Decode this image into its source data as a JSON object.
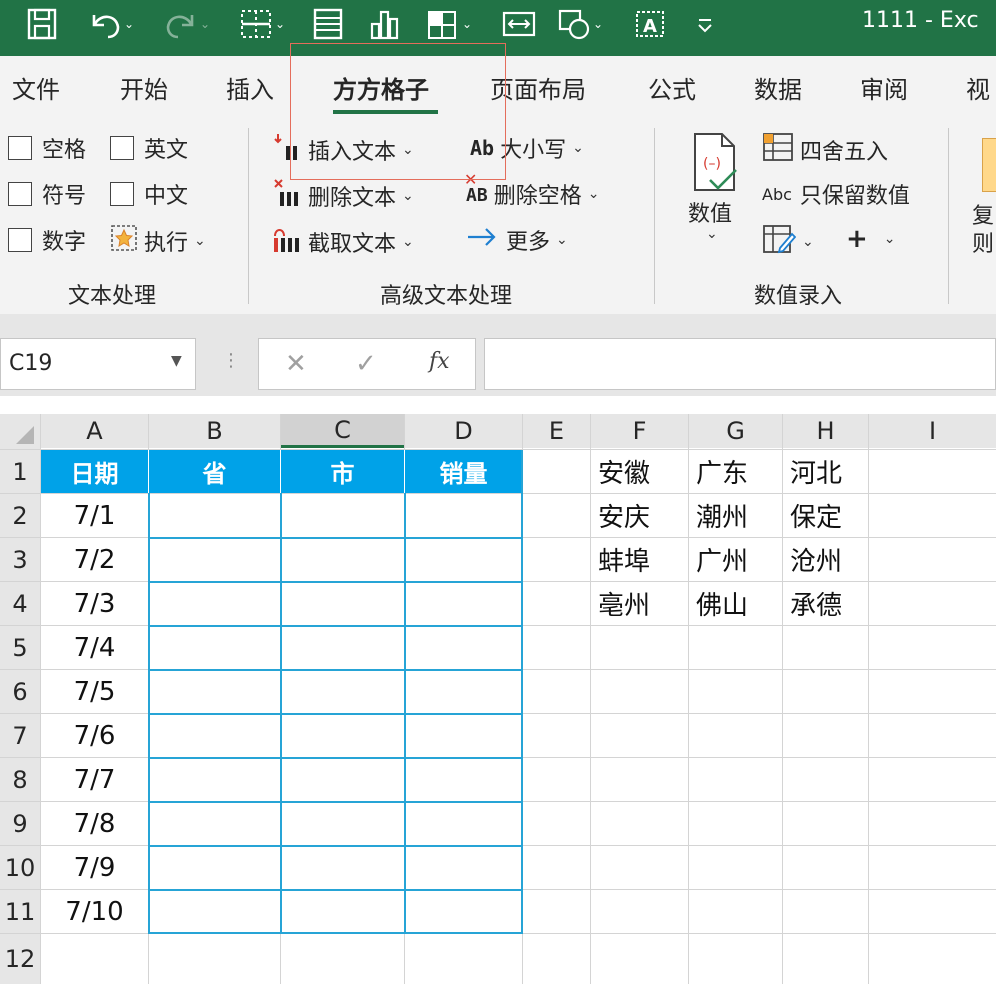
{
  "window": {
    "title": "1111 - Exc"
  },
  "ribbon_tabs": [
    "文件",
    "开始",
    "插入",
    "方方格子",
    "页面布局",
    "公式",
    "数据",
    "审阅",
    "视"
  ],
  "active_tab": "方方格子",
  "groups": {
    "text_processing": {
      "label": "文本处理",
      "checkboxes": [
        "空格",
        "英文",
        "符号",
        "中文",
        "数字"
      ],
      "execute": "执行"
    },
    "advanced_text": {
      "label": "高级文本处理",
      "insert_text": "插入文本",
      "delete_text": "删除文本",
      "extract_text": "截取文本",
      "case": "大小写",
      "delete_spaces": "删除空格",
      "more": "更多",
      "ab_icon": "Ab",
      "ab_icon2": "AB"
    },
    "number_entry": {
      "label": "数值录入",
      "number_btn": "数值",
      "round": "四舍五入",
      "keep_numbers": "只保留数值",
      "abc_icon": "Abc",
      "plus": "+"
    },
    "partial_next": [
      "复",
      "则"
    ]
  },
  "formula_bar": {
    "name_box": "C19",
    "fx": "fx",
    "cancel": "✕",
    "confirm": "✓",
    "content": ""
  },
  "sheet": {
    "columns": [
      "A",
      "B",
      "C",
      "D",
      "E",
      "F",
      "G",
      "H",
      "I"
    ],
    "selected_column": "C",
    "rows": [
      "1",
      "2",
      "3",
      "4",
      "5",
      "6",
      "7",
      "8",
      "9",
      "10",
      "11",
      "12"
    ],
    "table_headers": [
      "日期",
      "省",
      "市",
      "销量"
    ],
    "dates": [
      "7/1",
      "7/2",
      "7/3",
      "7/4",
      "7/5",
      "7/6",
      "7/7",
      "7/8",
      "7/9",
      "7/10"
    ],
    "side_table": [
      [
        "安徽",
        "广东",
        "河北"
      ],
      [
        "安庆",
        "潮州",
        "保定"
      ],
      [
        "蚌埠",
        "广州",
        "沧州"
      ],
      [
        "亳州",
        "佛山",
        "承德"
      ]
    ]
  },
  "colors": {
    "title_bar": "#217346",
    "header_fill": "#00a2e8",
    "table_border": "#26a4d6",
    "highlight_box": "#e46d5b"
  }
}
